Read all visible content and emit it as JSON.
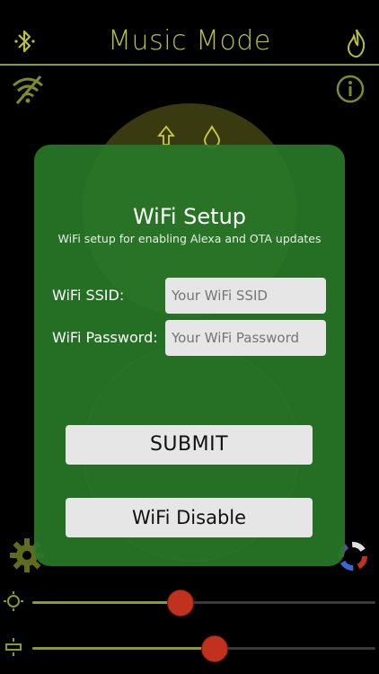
{
  "header": {
    "title": "Music Mode",
    "left_icon": "bluetooth-icon",
    "right_icon": "flame-icon"
  },
  "status": {
    "wifi_icon": "wifi-off-icon",
    "info_icon": "info-icon"
  },
  "modal": {
    "title": "WiFi Setup",
    "subtitle": "WiFi setup for enabling Alexa and OTA updates",
    "ssid_label": "WiFi SSID:",
    "ssid_placeholder": "Your WiFi SSID",
    "password_label": "WiFi Password:",
    "password_placeholder": "Your WiFi Password",
    "submit_label": "SUBMIT",
    "disable_label": "WiFi Disable"
  },
  "footer": {
    "settings_icon": "gear-icon",
    "color_icon": "color-wheel-icon",
    "brightness_icon": "brightness-icon",
    "speed_icon": "speed-icon",
    "brightness_level": 0.43,
    "speed_level": 0.53
  },
  "colors": {
    "accent": "#b8c232",
    "modal_bg": "#287828",
    "thumb": "#c0321e"
  }
}
